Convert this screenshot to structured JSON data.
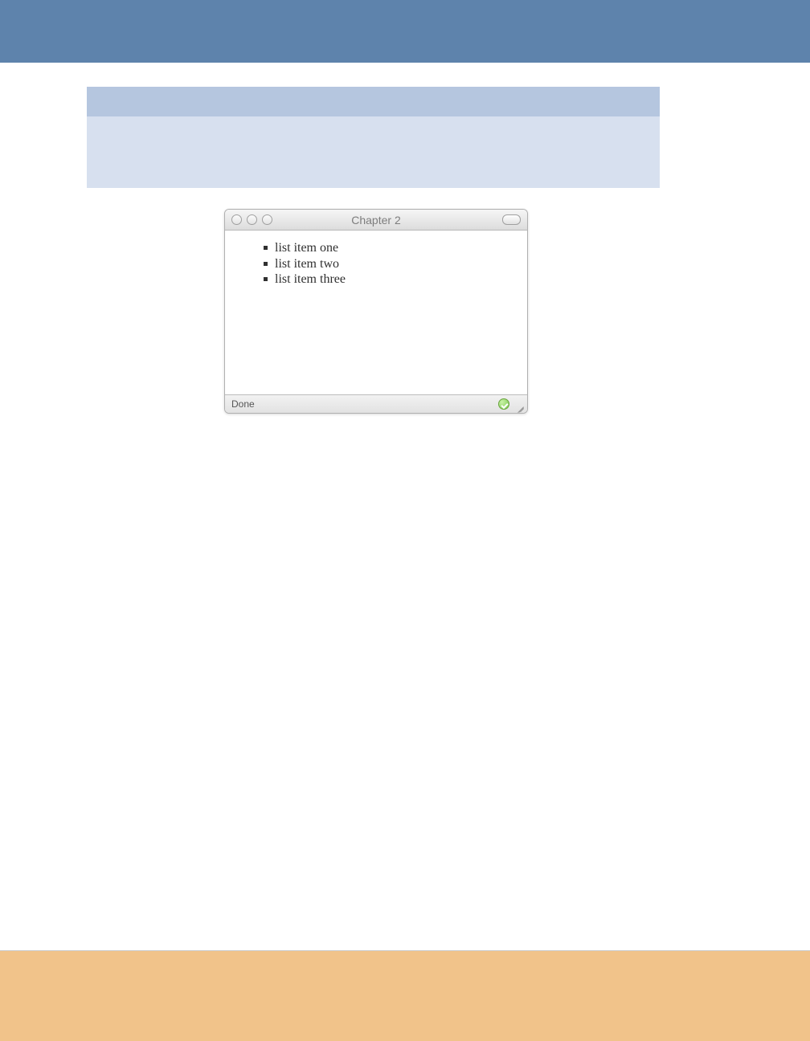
{
  "window": {
    "title": "Chapter 2",
    "status": "Done",
    "list_items": [
      "list item one",
      "list item two",
      "list item three"
    ]
  },
  "colors": {
    "top_band": "#5e83ac",
    "panel_head": "#b5c6df",
    "panel_body": "#d7e0ef",
    "bottom_band": "#f1c38a"
  }
}
